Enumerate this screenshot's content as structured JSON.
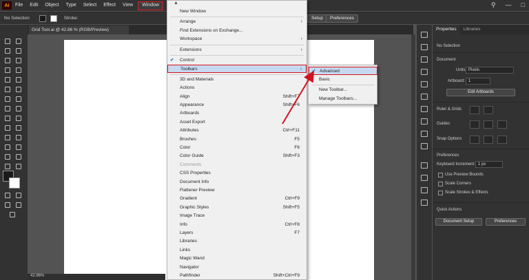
{
  "menubar": {
    "logo": "Ai",
    "items": [
      "File",
      "Edit",
      "Object",
      "Type",
      "Select",
      "Effect",
      "View",
      "Window"
    ]
  },
  "control_bar": {
    "selection_label": "No Selection",
    "stroke_label": "Stroke:",
    "setup_button": "Setup",
    "preferences_button": "Preferences"
  },
  "document_tab": "Grid Tool.ai @ 42.86 % (RGB/Preview)",
  "zoom_readout": "42.86%",
  "window_menu": {
    "items": [
      {
        "label": "New Window"
      },
      {
        "sep": true
      },
      {
        "label": "Arrange",
        "arrow": true
      },
      {
        "label": "Find Extensions on Exchange..."
      },
      {
        "label": "Workspace",
        "arrow": true
      },
      {
        "sep": true
      },
      {
        "label": "Extensions",
        "arrow": true
      },
      {
        "sep": true
      },
      {
        "label": "Control",
        "checked": true
      },
      {
        "label": "Toolbars",
        "arrow": true,
        "highlight": true
      },
      {
        "sep": true
      },
      {
        "label": "3D and Materials"
      },
      {
        "label": "Actions"
      },
      {
        "label": "Align",
        "shortcut": "Shift+F7"
      },
      {
        "label": "Appearance",
        "shortcut": "Shift+F6"
      },
      {
        "label": "Artboards"
      },
      {
        "label": "Asset Export"
      },
      {
        "label": "Attributes",
        "shortcut": "Ctrl+F11"
      },
      {
        "label": "Brushes",
        "shortcut": "F5"
      },
      {
        "label": "Color",
        "shortcut": "F6"
      },
      {
        "label": "Color Guide",
        "shortcut": "Shift+F3"
      },
      {
        "label": "Comments",
        "disabled": true
      },
      {
        "label": "CSS Properties"
      },
      {
        "label": "Document Info"
      },
      {
        "label": "Flattener Preview"
      },
      {
        "label": "Gradient",
        "shortcut": "Ctrl+F9"
      },
      {
        "label": "Graphic Styles",
        "shortcut": "Shift+F5"
      },
      {
        "label": "Image Trace"
      },
      {
        "label": "Info",
        "shortcut": "Ctrl+F8"
      },
      {
        "label": "Layers",
        "shortcut": "F7"
      },
      {
        "label": "Libraries"
      },
      {
        "label": "Links"
      },
      {
        "label": "Magic Wand"
      },
      {
        "label": "Navigator"
      },
      {
        "label": "Pathfinder",
        "shortcut": "Shift+Ctrl+F9"
      }
    ]
  },
  "toolbars_submenu": {
    "items": [
      {
        "label": "Advanced",
        "checked": true,
        "highlight": true
      },
      {
        "label": "Basic"
      },
      {
        "sep": true
      },
      {
        "label": "New Toolbar..."
      },
      {
        "label": "Manage Toolbars..."
      }
    ]
  },
  "properties_panel": {
    "tabs": [
      "Properties",
      "Libraries"
    ],
    "no_selection": "No Selection",
    "document_heading": "Document",
    "units_label": "Units:",
    "units_value": "Pixels",
    "artboard_label": "Artboard:",
    "artboard_value": "1",
    "edit_artboards_button": "Edit Artboards",
    "ruler_grids": "Ruler & Grids",
    "guides": "Guides",
    "snap_options": "Snap Options",
    "preferences_heading": "Preferences",
    "keyboard_increment_label": "Keyboard Increment:",
    "keyboard_increment_value": "1 px",
    "checkboxes": [
      "Use Preview Bounds",
      "Scale Corners",
      "Scale Strokes & Effects"
    ],
    "quick_actions_heading": "Quick Actions",
    "document_setup_button": "Document Setup",
    "preferences_button": "Preferences"
  },
  "colors": {
    "highlight_border": "#d0131c",
    "menu_highlight": "#c7d9f0",
    "check": "#1f74d4",
    "app_bg": "#535353",
    "panel_bg": "#323232"
  }
}
